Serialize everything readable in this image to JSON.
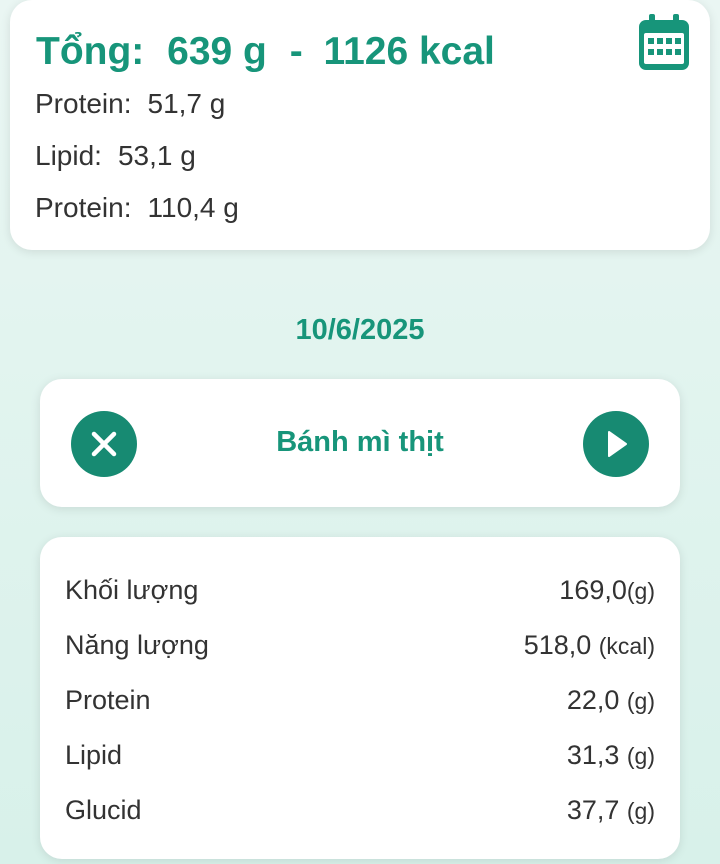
{
  "summary": {
    "total_label": "Tổng:",
    "total_weight": "639 g",
    "separator": "-",
    "total_energy": "1126 kcal",
    "nutrients": [
      {
        "label": "Protein:",
        "value": "51,7 g"
      },
      {
        "label": "Lipid:",
        "value": "53,1 g"
      },
      {
        "label": "Protein:",
        "value": "110,4 g"
      }
    ],
    "calendar_icon": "calendar-icon"
  },
  "date": "10/6/2025",
  "food": {
    "name": "Bánh mì thịt",
    "remove_icon": "close-circle-icon",
    "next_icon": "play-circle-icon"
  },
  "details": [
    {
      "label": "Khối lượng",
      "value": "169,0",
      "unit": "(g)"
    },
    {
      "label": "Năng lượng",
      "value": "518,0 ",
      "unit": "(kcal)"
    },
    {
      "label": "Protein",
      "value": "22,0 ",
      "unit": "(g)"
    },
    {
      "label": "Lipid",
      "value": "31,3 ",
      "unit": "(g)"
    },
    {
      "label": "Glucid",
      "value": "37,7 ",
      "unit": "(g)"
    }
  ],
  "colors": {
    "accent": "#17957a",
    "button": "#178a72",
    "text": "#333333",
    "background": "#e2f4ef"
  }
}
